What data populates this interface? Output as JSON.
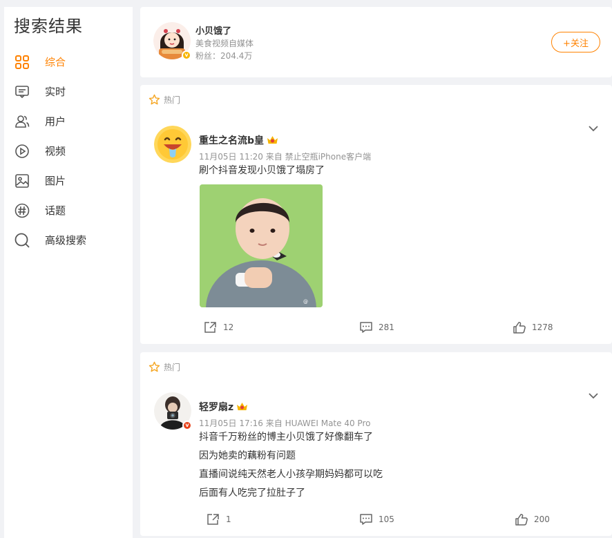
{
  "sidebar": {
    "title": "搜索结果",
    "items": [
      {
        "label": "综合",
        "icon": "grid-icon",
        "active": true
      },
      {
        "label": "实时",
        "icon": "message-icon"
      },
      {
        "label": "用户",
        "icon": "users-icon"
      },
      {
        "label": "视频",
        "icon": "play-icon"
      },
      {
        "label": "图片",
        "icon": "image-icon"
      },
      {
        "label": "话题",
        "icon": "hashtag-icon"
      },
      {
        "label": "高级搜索",
        "icon": "search-icon"
      }
    ]
  },
  "user_card": {
    "name": "小贝饿了",
    "desc": "美食视频自媒体",
    "fans": "粉丝：204.4万",
    "follow_label": "+关注"
  },
  "posts": [
    {
      "hot_label": "热门",
      "author": "重生之名流b皇",
      "meta": "11月05日 11:20  来自 禁止空瓶iPhone客户端",
      "lines": [
        "刷个抖音发现小贝饿了塌房了"
      ],
      "repost": "12",
      "comment": "281",
      "like": "1278"
    },
    {
      "hot_label": "热门",
      "author": "轻罗扇z",
      "meta": "11月05日 17:16  来自 HUAWEI Mate 40 Pro",
      "lines": [
        "抖音千万粉丝的博主小贝饿了好像翻车了",
        "因为她卖的藕粉有问题",
        "直播间说纯天然老人小孩孕期妈妈都可以吃",
        "后面有人吃完了拉肚子了"
      ],
      "repost": "1",
      "comment": "105",
      "like": "200"
    }
  ],
  "colors": {
    "accent": "#ff8200",
    "muted": "#939393",
    "bg": "#f1f2f5"
  }
}
